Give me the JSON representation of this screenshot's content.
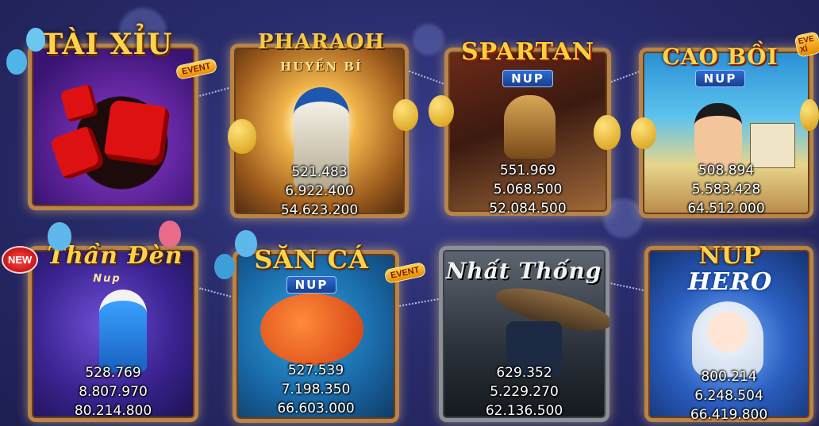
{
  "games": [
    {
      "id": "tai-xiu",
      "title": "TÀI XỈU",
      "badge": "EVENT",
      "jackpots": []
    },
    {
      "id": "pharaoh",
      "title": "PHARAOH",
      "subtitle": "HUYỀN BÍ",
      "jackpots": [
        "521.483",
        "6.922.400",
        "54.623.200"
      ]
    },
    {
      "id": "spartan",
      "title": "SPARTAN",
      "subtitle": "NUP",
      "jackpots": [
        "551.969",
        "5.068.500",
        "52.084.500"
      ]
    },
    {
      "id": "cao-boi",
      "title": "CAO BỒI",
      "subtitle": "NUP",
      "badge": "EVE XỈ",
      "jackpots": [
        "508.894",
        "5.583.428",
        "64.512.000"
      ]
    },
    {
      "id": "than-den",
      "title": "Thần Đèn",
      "subtitle": "Nup",
      "badge": "NEW",
      "jackpots": [
        "528.769",
        "8.807.970",
        "80.214.800"
      ]
    },
    {
      "id": "san-ca",
      "title": "SĂN CÁ",
      "subtitle": "NUP",
      "badge": "EVENT",
      "jackpots": [
        "527.539",
        "7.198.350",
        "66.603.000"
      ]
    },
    {
      "id": "nhat-thong",
      "title": "Nhất Thống",
      "jackpots": [
        "629.352",
        "5.229.270",
        "62.136.500"
      ]
    },
    {
      "id": "nup-hero",
      "title": "NUP",
      "subtitle": "HERO",
      "jackpots": [
        "800.214",
        "6.248.504",
        "66.419.800"
      ]
    }
  ]
}
